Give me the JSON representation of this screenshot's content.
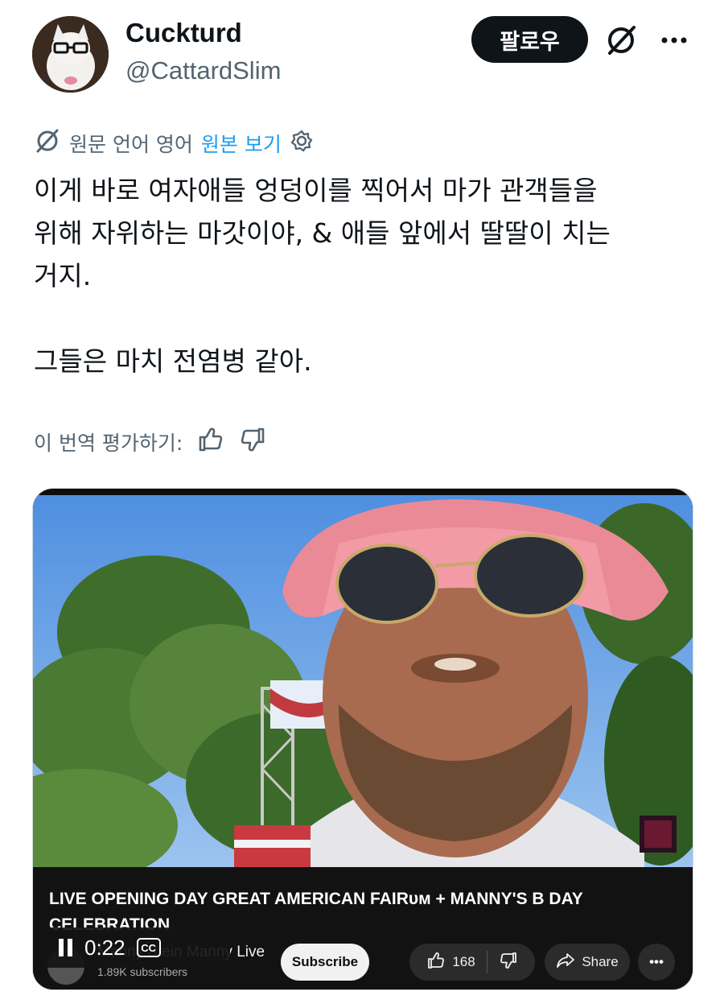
{
  "author": {
    "display_name": "Cuckturd",
    "handle": "@CattardSlim",
    "follow_label": "팔로우"
  },
  "translation": {
    "info": "원문 언어 영어",
    "view_original": "원본 보기",
    "rate_prompt": "이 번역 평가하기:"
  },
  "tweet": {
    "text": "이게 바로 여자애들 엉덩이를 찍어서 마가 관객들을\n위해 자위하는 마갓이야, & 애들 앞에서 딸딸이 치는\n거지.\n\n그들은 마치 전염병 같아."
  },
  "video": {
    "title": "LIVE OPENING DAY GREAT AMERICAN FAIRᴜᴍ + MANNY'S B DAY CELEBRATION",
    "channel_name": "Manny Stein Manny Live",
    "subscribers": "1.89K subscribers",
    "subscribe_label": "Subscribe",
    "like_count": "168",
    "share_label": "Share",
    "more_label": "•••",
    "time": "0:22",
    "cc_label": "CC"
  },
  "icons": {
    "grok": "grok-icon",
    "more": "more-icon",
    "settings": "gear-icon",
    "thumbs_up": "thumbs-up-icon",
    "thumbs_down": "thumbs-down-icon"
  },
  "colors": {
    "accent": "#1d9bf0",
    "text": "#0f1419",
    "muted": "#536471"
  }
}
